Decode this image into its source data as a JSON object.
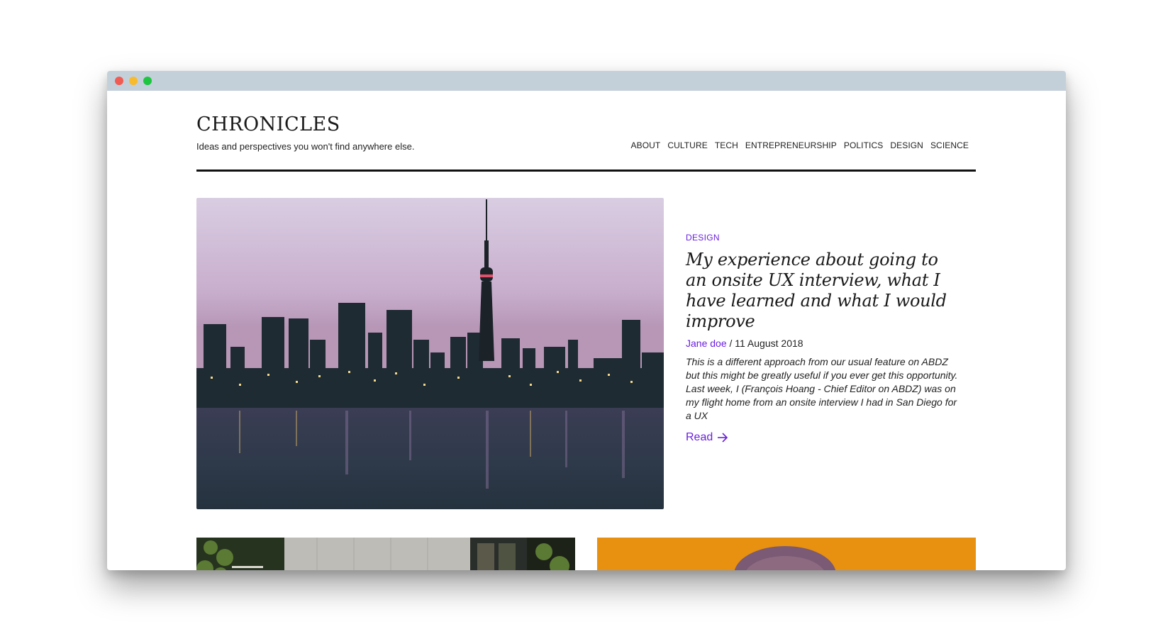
{
  "site": {
    "logo": "CHRONICLES",
    "tagline": "Ideas and perspectives you won't find anywhere else."
  },
  "nav": {
    "items": [
      "ABOUT",
      "CULTURE",
      "TECH",
      "ENTREPRENEURSHIP",
      "POLITICS",
      "DESIGN",
      "SCIENCE"
    ]
  },
  "featured": {
    "category": "DESIGN",
    "title": "My experience about going to an onsite UX interview, what I have learned and what I would improve",
    "author": "Jane doe",
    "separator": " / ",
    "date": "11 August 2018",
    "excerpt": "This is a different approach from our usual feature on ABDZ but this might be greatly useful if you ever get this opportunity. Last week, I (François Hoang - Chief Editor on ABDZ) was on my flight home from an onsite interview I had in San Diego for a UX",
    "read_label": "Read",
    "read_icon": "arrow-right-icon",
    "image": "city-skyline-photo"
  },
  "cards": {
    "left_image": "building-night-photo",
    "right_image": "portrait-orange-photo"
  },
  "colors": {
    "accent": "#6a1fdf",
    "titlebar": "#c3d0da",
    "card_right_bg": "#e8900f"
  }
}
